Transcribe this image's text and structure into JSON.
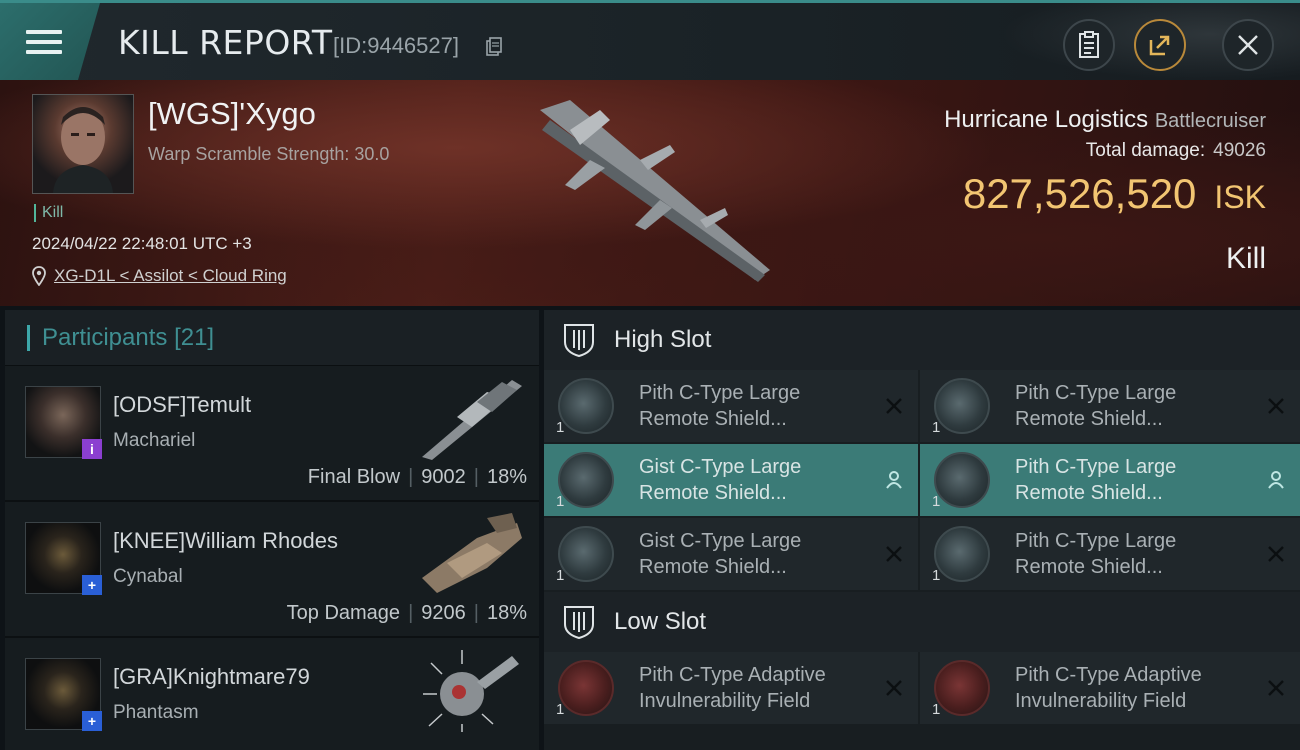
{
  "header": {
    "title": "KILL REPORT",
    "report_id": "[ID:9446527]"
  },
  "victim": {
    "name": "[WGS]'Xygo",
    "warp_scramble": "Warp Scramble Strength: 30.0",
    "tag": "Kill",
    "datetime": "2024/04/22 22:48:01 UTC +3",
    "location": "XG-D1L < Assilot < Cloud Ring",
    "ship_name": "Hurricane Logistics",
    "ship_class": "Battlecruiser",
    "total_damage_label": "Total damage:",
    "total_damage": "49026",
    "isk_value": "827,526,520",
    "isk_unit": "ISK",
    "result": "Kill"
  },
  "participants": {
    "label": "Participants",
    "count": "[21]",
    "rows": [
      {
        "name": "[ODSF]Temult",
        "ship": "Machariel",
        "role": "Final Blow",
        "damage": "9002",
        "percent": "18%",
        "badge": "i"
      },
      {
        "name": "[KNEE]William Rhodes",
        "ship": "Cynabal",
        "role": "Top Damage",
        "damage": "9206",
        "percent": "18%",
        "badge": "+"
      },
      {
        "name": "[GRA]Knightmare79",
        "ship": "Phantasm",
        "role": "",
        "damage": "",
        "percent": "",
        "badge": "+"
      }
    ]
  },
  "high_slot": {
    "label": "High Slot",
    "modules": [
      {
        "name": "Pith C-Type Large Remote Shield...",
        "qty": "1",
        "action": "destroyed"
      },
      {
        "name": "Pith C-Type Large Remote Shield...",
        "qty": "1",
        "action": "destroyed"
      },
      {
        "name": "Gist C-Type Large Remote Shield...",
        "qty": "1",
        "action": "dropped"
      },
      {
        "name": "Pith C-Type Large Remote Shield...",
        "qty": "1",
        "action": "dropped"
      },
      {
        "name": "Gist C-Type Large Remote Shield...",
        "qty": "1",
        "action": "destroyed"
      },
      {
        "name": "Pith C-Type Large Remote Shield...",
        "qty": "1",
        "action": "destroyed"
      }
    ]
  },
  "low_slot": {
    "label": "Low Slot",
    "modules": [
      {
        "name": "Pith C-Type Adaptive Invulnerability Field",
        "qty": "1",
        "action": "destroyed"
      },
      {
        "name": "Pith C-Type Adaptive Invulnerability Field",
        "qty": "1",
        "action": "destroyed"
      }
    ]
  },
  "colors": {
    "accent": "#3b7b77",
    "isk": "#f2c572",
    "kill_tag": "#52b59a"
  }
}
